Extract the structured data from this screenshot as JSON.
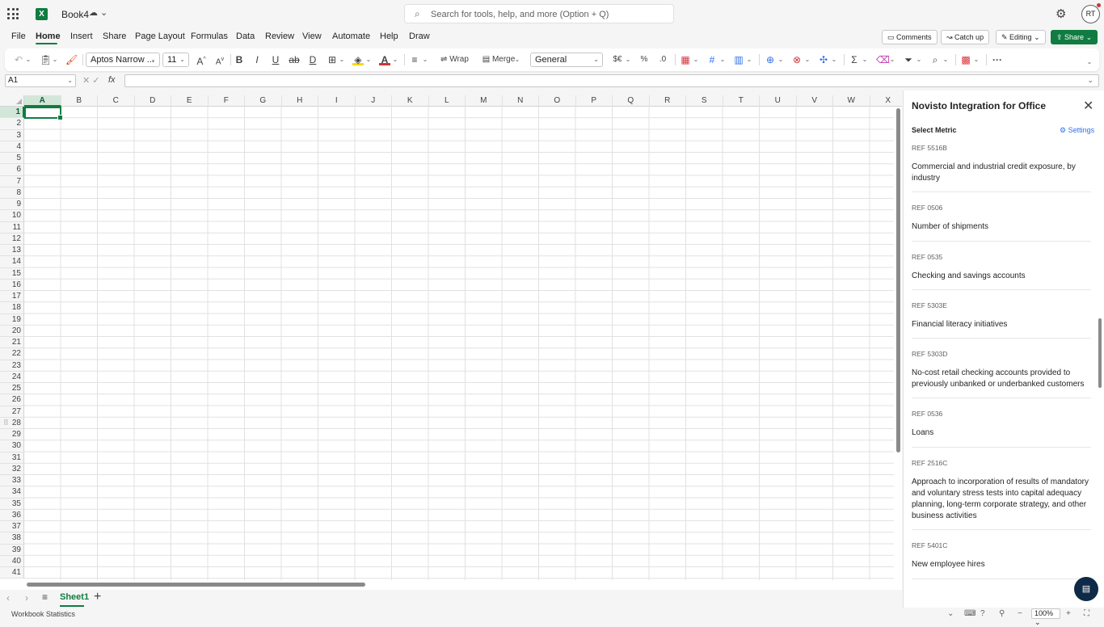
{
  "titlebar": {
    "book_name": "Book4",
    "book_status": "☁ ⌄",
    "search_placeholder": "Search for tools, help, and more (Option + Q)",
    "avatar_initials": "RT"
  },
  "menu_tabs": [
    "File",
    "Home",
    "Insert",
    "Share",
    "Page Layout",
    "Formulas",
    "Data",
    "Review",
    "View",
    "Automate",
    "Help",
    "Draw"
  ],
  "header_buttons": {
    "comments": "Comments",
    "catch_up": "Catch up",
    "editing": "Editing",
    "share": "Share"
  },
  "ribbon": {
    "font_name": "Aptos Narrow ...",
    "font_size": "11",
    "wrap": "Wrap",
    "merge": "Merge",
    "number_format": "General"
  },
  "formula_bar": {
    "name_box": "A1",
    "fx": "fx"
  },
  "grid": {
    "columns": [
      "A",
      "B",
      "C",
      "D",
      "E",
      "F",
      "G",
      "H",
      "I",
      "J",
      "K",
      "L",
      "M",
      "N",
      "O",
      "P",
      "Q",
      "R",
      "S",
      "T",
      "U",
      "V",
      "W",
      "X"
    ],
    "rows": [
      "1",
      "2",
      "3",
      "4",
      "5",
      "6",
      "7",
      "8",
      "9",
      "10",
      "11",
      "12",
      "13",
      "14",
      "15",
      "16",
      "17",
      "18",
      "19",
      "20",
      "21",
      "22",
      "23",
      "24",
      "25",
      "26",
      "27",
      "28",
      "29",
      "30",
      "31",
      "32",
      "33",
      "34",
      "35",
      "36",
      "37",
      "38",
      "39",
      "40",
      "41"
    ],
    "selected_column": "A",
    "selected_row": "1"
  },
  "sheets": {
    "active": "Sheet1"
  },
  "status": {
    "workbook_statistics": "Workbook Statistics",
    "zoom": "100%"
  },
  "pane": {
    "title": "Novisto Integration for Office",
    "subtitle": "Select Metric",
    "settings": "Settings",
    "metrics": [
      {
        "ref": "REF 5516B",
        "name": "Commercial and industrial credit exposure, by industry"
      },
      {
        "ref": "REF 0506",
        "name": "Number of shipments"
      },
      {
        "ref": "REF 0535",
        "name": "Checking and savings accounts"
      },
      {
        "ref": "REF 5303E",
        "name": "Financial literacy initiatives"
      },
      {
        "ref": "REF 5303D",
        "name": "No-cost retail checking accounts provided to previously unbanked or underbanked customers"
      },
      {
        "ref": "REF 0536",
        "name": "Loans"
      },
      {
        "ref": "REF 2516C",
        "name": "Approach to incorporation of results of mandatory and voluntary stress tests into capital adequacy planning, long-term corporate strategy, and other business activities"
      },
      {
        "ref": "REF 5401C",
        "name": "New employee hires"
      }
    ]
  }
}
